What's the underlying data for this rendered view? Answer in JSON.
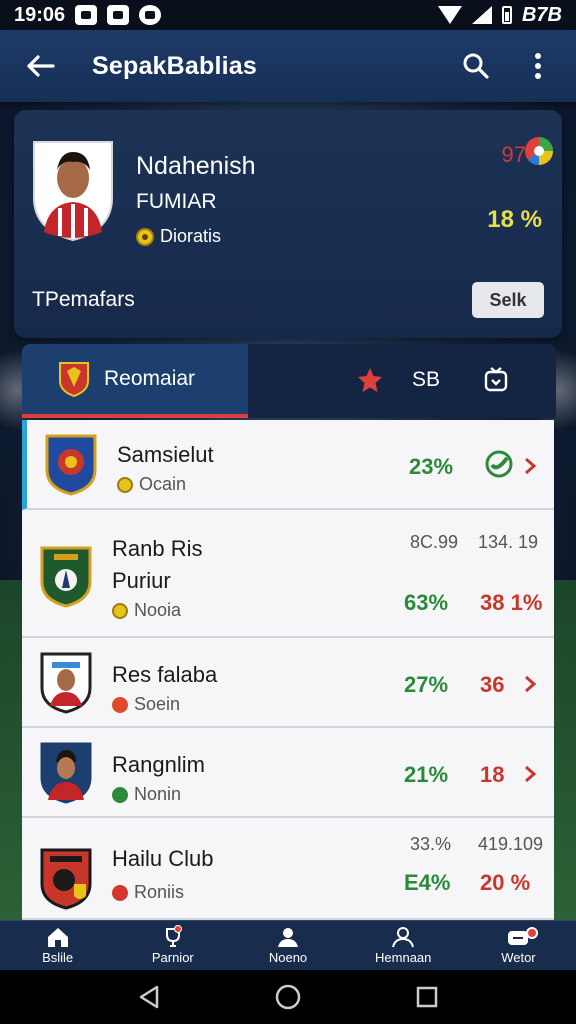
{
  "status_bar": {
    "time": "19:06",
    "battery_text": "B7B"
  },
  "app_bar": {
    "title": "SepakBablias"
  },
  "profile": {
    "name": "Ndahenish",
    "subtitle": "FUMIAR",
    "tag": "Dioratis",
    "stat_top": "97̃",
    "stat_main": "18 %",
    "bottom_label": "TPemafars",
    "select_button": "Selk"
  },
  "tabs": {
    "active_label": "Reomaiar",
    "count": "SB"
  },
  "list": [
    {
      "name": "Samsielut",
      "sub": "Ocain",
      "stat_a": "23%",
      "stat_b": "",
      "top_a": "",
      "top_b": ""
    },
    {
      "name": "Ranb Ris",
      "name2": "Puriur",
      "sub": "Nooia",
      "stat_a": "63%",
      "stat_b": "38 1%",
      "top_a": "8C.99",
      "top_b": "134. 19"
    },
    {
      "name": "Res falaba",
      "sub": "Soein",
      "stat_a": "27%",
      "stat_b": "36",
      "top_a": "",
      "top_b": ""
    },
    {
      "name": "Rangnlim",
      "sub": "Nonin",
      "stat_a": "21%",
      "stat_b": "18",
      "top_a": "",
      "top_b": ""
    },
    {
      "name": "Hailu Club",
      "sub": "Roniis",
      "stat_a": "E4%",
      "stat_b": "20 %",
      "top_a": "33.%",
      "top_b": "419.109"
    }
  ],
  "bottom_nav": [
    {
      "label": "Bslile"
    },
    {
      "label": "Parnior"
    },
    {
      "label": "Noeno"
    },
    {
      "label": "Hemnaan"
    },
    {
      "label": "Wetor"
    }
  ],
  "colors": {
    "appbar": "#1d3a68",
    "card": "#1c3356",
    "accent_red": "#e0403a",
    "stat_green": "#2a8a3a",
    "stat_red": "#c9372c",
    "highlight_yellow": "#e8df4a"
  }
}
